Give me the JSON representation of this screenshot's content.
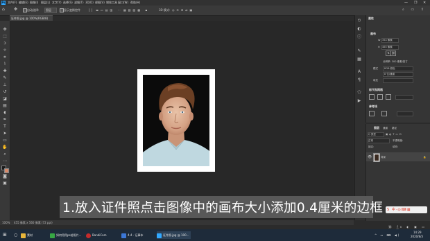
{
  "app": {
    "name": "Photoshop",
    "logo_text": "Ps"
  },
  "menu": [
    "文件(F)",
    "编辑(E)",
    "图像(I)",
    "图层(L)",
    "文字(Y)",
    "选择(S)",
    "滤镜(T)",
    "3D(D)",
    "视图(V)",
    "增效工具",
    "窗口(W)",
    "帮助(H)"
  ],
  "window_controls": [
    "—",
    "❐",
    "✕"
  ],
  "options_bar": {
    "auto_select": "自动选择:",
    "layer_dropdown": "图层",
    "show_transform": "显示变换控件",
    "mode3d": "3D 模式:"
  },
  "document_tab": {
    "title": "证件照.jpg @ 100%(RGB/8)"
  },
  "status_bar": {
    "zoom": "100%",
    "doc_info": "455 像素 x 560 像素 (72 ppi)"
  },
  "properties": {
    "panel_title": "属性",
    "section_canvas": "画布",
    "w_label": "W",
    "w_value": "354 像素",
    "h_label": "H",
    "h_value": "465 像素",
    "resolution": "分辨率: 300 像素/英寸",
    "mode_label": "模式",
    "mode_value": "RGB 颜色",
    "bit_value": "8 位/通道",
    "fill_label": "填充",
    "section_align": "标尺和网格",
    "section_guides": "参考线"
  },
  "layers": {
    "tabs": [
      "图层",
      "通道",
      "路径"
    ],
    "kind_label": "Q 类型",
    "blend_mode": "正常",
    "opacity_label": "不透明度:",
    "lock_label": "锁定:",
    "fill_label": "填充:",
    "layer_name": "背景"
  },
  "caption": {
    "text": "1.放入证件照点击图像中的画布大小添加0.4厘米的边框"
  },
  "taskbar": {
    "items": [
      {
        "label": "素材",
        "color": "#e8b53a"
      },
      {
        "label": "如何用用ps给照片...",
        "color": "#37a744"
      },
      {
        "label": "BandiCam",
        "color": "#c42b2b"
      },
      {
        "label": "4.4 - 记事本",
        "color": "#3c78d8"
      },
      {
        "label": "证件照.jpg @ 100...",
        "color": "#31a8ff"
      }
    ],
    "time": "14:29",
    "date": "2020/8/3"
  },
  "colors": {
    "accent": "#31a8ff",
    "caption_bg": "#5b5b5b",
    "canvas_bg": "#282828",
    "panel_bg": "#353535"
  },
  "tools": [
    "move-icon",
    "marquee-icon",
    "lasso-icon",
    "magic-wand-icon",
    "crop-icon",
    "eyedropper-icon",
    "healing-icon",
    "brush-icon",
    "stamp-icon",
    "history-brush-icon",
    "eraser-icon",
    "gradient-icon",
    "blur-icon",
    "dodge-icon",
    "pen-icon",
    "type-icon",
    "path-select-icon",
    "shape-icon",
    "hand-icon",
    "zoom-icon",
    "more-icon"
  ]
}
